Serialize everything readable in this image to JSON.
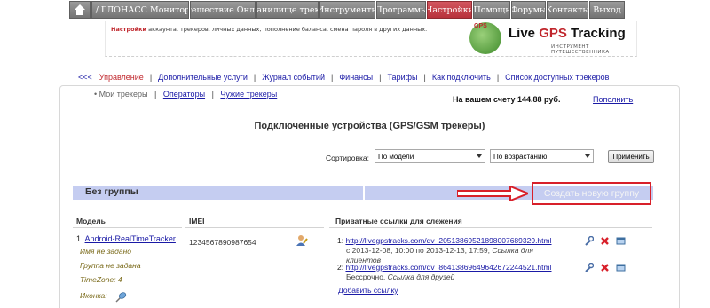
{
  "topnav": {
    "items": [
      {
        "label": "",
        "icon": "home-icon"
      },
      {
        "label": "GPS / ГЛОНАСС Мониторинг"
      },
      {
        "label": "Путешествие Онлайн"
      },
      {
        "label": "Хранилище треков"
      },
      {
        "label": "Инструменты"
      },
      {
        "label": "Программы"
      },
      {
        "label": "Настройки",
        "active": true
      },
      {
        "label": "Помощь"
      },
      {
        "label": "Форумы"
      },
      {
        "label": "Контакты"
      },
      {
        "label": "Выход"
      }
    ]
  },
  "banner": {
    "settings_word": "Настройки",
    "settings_text": "аккаунта, трекеров, личных данных, пополнение баланса, смена пароля в других данных.",
    "logo_mark": "GPS",
    "logo_title_1": "Live ",
    "logo_title_2": "GPS",
    "logo_title_3": " Tracking",
    "logo_sub": "ИНСТРУМЕНТ ПУТЕШЕСТВЕННИКА"
  },
  "subnav": {
    "back": "<<<",
    "items": [
      "Управление",
      "Дополнительные услуги",
      "Журнал событий",
      "Финансы",
      "Тарифы",
      "Как подключить",
      "Список доступных трекеров"
    ]
  },
  "crumbs": {
    "current": "Мои трекеры",
    "operators": "Операторы",
    "others": "Чужие трекеры"
  },
  "account": {
    "balance": "На вашем счету 144.88 руб.",
    "topup": "Пополнить"
  },
  "page_title": "Подключенные устройства (GPS/GSM трекеры)",
  "sorting": {
    "label": "Сортировка:",
    "field": "По модели",
    "order": "По возрастанию",
    "apply": "Применить"
  },
  "group": {
    "title": "Без группы",
    "create": "Создать новую группу"
  },
  "columns": {
    "model": "Модель",
    "imei": "IMEI",
    "links": "Приватные ссылки для слежения"
  },
  "device": {
    "index": "1.",
    "name": "Android-RealTimeTracker",
    "name_meta": "Имя не задано",
    "group_meta": "Группа не задана",
    "timezone": "TimeZone: 4",
    "icon_label": "Иконка:",
    "imei": "1234567890987654"
  },
  "links": [
    {
      "index": "1:",
      "url": "http://livegpstracks.com/dv_20513869521898007689329.html",
      "period": "с 2013-12-08, 10:00 по 2013-12-13, 17:59,",
      "note": "Ссылка для",
      "note2": "клиентов"
    },
    {
      "index": "2:",
      "url": "http://livegpstracks.com/dv_86413869649642672244521.html",
      "period": "Бессрочно,",
      "note": "Ссылка для друзей"
    }
  ],
  "add_link": "Добавить ссылку",
  "colors": {
    "accent_red": "#d8202a",
    "link_blue": "#1a1aa6",
    "group_bar": "#c5cdf1",
    "nav_gray": "#858585"
  }
}
